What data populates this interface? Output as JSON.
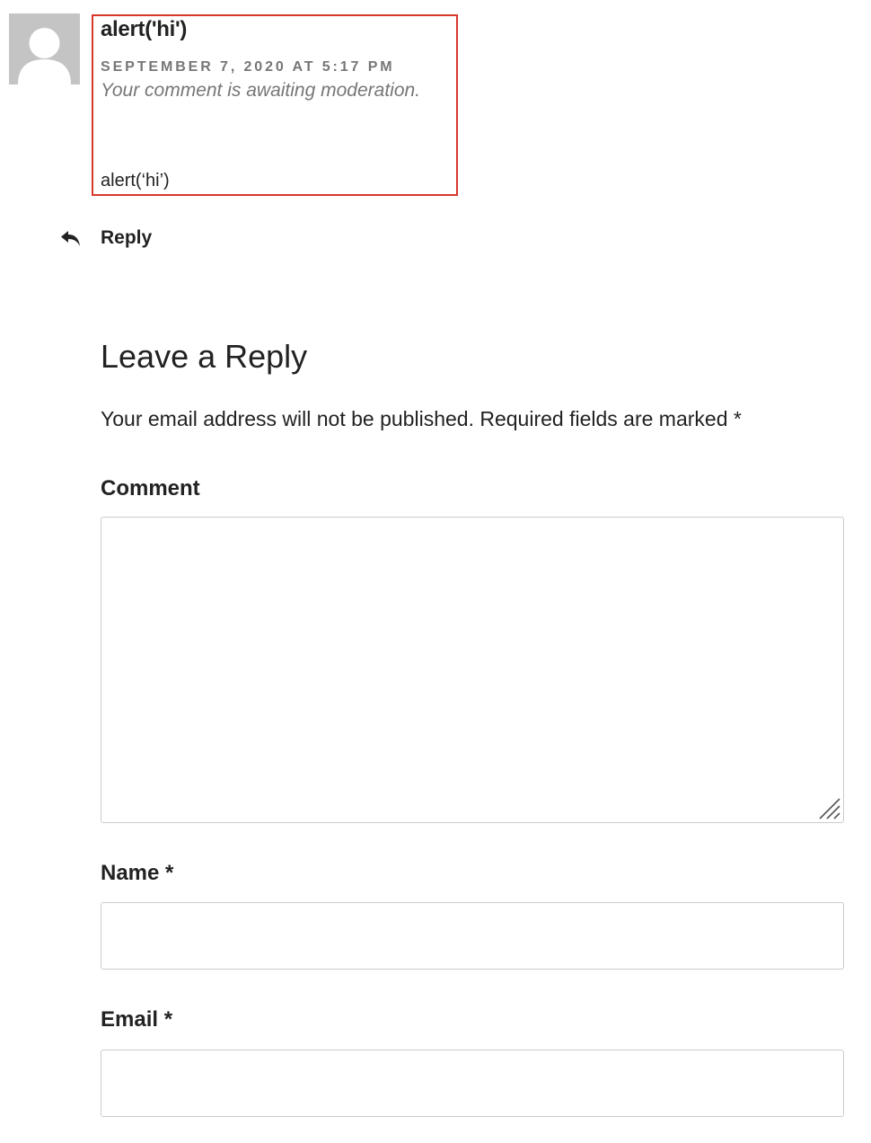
{
  "comment": {
    "author": "alert('hi')",
    "date": "SEPTEMBER 7, 2020 AT 5:17 PM",
    "moderation_notice": "Your comment is awaiting moderation.",
    "content": "alert(‘hi’)",
    "reply_label": "Reply",
    "highlight_color": "#d9372b"
  },
  "respond": {
    "title": "Leave a Reply",
    "notes": "Your email address will not be published. Required fields are marked *",
    "comment_label": "Comment",
    "name_label": "Name *",
    "email_label": "Email *",
    "comment_value": "",
    "name_value": "",
    "email_value": ""
  },
  "icons": {
    "avatar": "default-avatar-icon",
    "reply": "reply-arrow-icon",
    "resize": "resize-grip-icon"
  }
}
